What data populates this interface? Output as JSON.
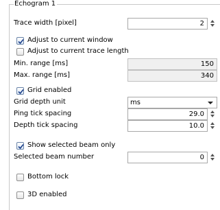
{
  "group": {
    "title": "Echogram 1"
  },
  "trace_width": {
    "label": "Trace width [pixel]",
    "value": "2"
  },
  "adjust_window": {
    "label": "Adjust to current window",
    "checked": true
  },
  "adjust_trace": {
    "label": "Adjust to current trace length",
    "checked": false
  },
  "min_range": {
    "label": "Min. range [ms]",
    "value": "150"
  },
  "max_range": {
    "label": "Max. range [ms]",
    "value": "340"
  },
  "grid_enabled": {
    "label": "Grid enabled",
    "checked": true
  },
  "grid_depth_unit": {
    "label": "Grid depth unit",
    "value": "ms"
  },
  "ping_tick": {
    "label": "Ping tick spacing",
    "value": "29.0"
  },
  "depth_tick": {
    "label": "Depth tick spacing",
    "value": "10.0"
  },
  "show_selected_beam": {
    "label": "Show selected beam only",
    "checked": true
  },
  "selected_beam": {
    "label": "Selected beam number",
    "value": "0"
  },
  "bottom_lock": {
    "label": "Bottom lock",
    "checked": false
  },
  "enabled_3d": {
    "label": "3D enabled",
    "checked": false
  }
}
